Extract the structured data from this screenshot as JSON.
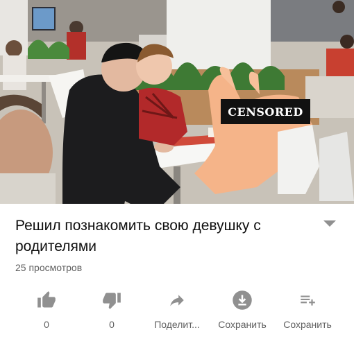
{
  "video": {
    "censor_label": "CENSORED"
  },
  "title": "Решил познакомить свою девушку с родителями",
  "views": "25 просмотров",
  "actions": [
    {
      "name": "like",
      "icon": "thumb-up-icon",
      "label": "0"
    },
    {
      "name": "dislike",
      "icon": "thumb-down-icon",
      "label": "0"
    },
    {
      "name": "share",
      "icon": "share-icon",
      "label": "Поделит..."
    },
    {
      "name": "download",
      "icon": "download-icon",
      "label": "Сохранить"
    },
    {
      "name": "save",
      "icon": "playlist-add-icon",
      "label": "Сохранить"
    }
  ],
  "colors": {
    "icon": "#909090",
    "text_secondary": "#606060",
    "title": "#0f0f0f"
  }
}
